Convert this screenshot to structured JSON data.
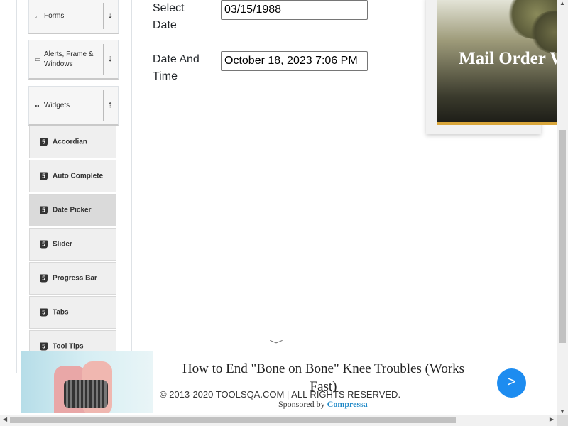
{
  "sidebar": {
    "groups": [
      {
        "label": "Forms",
        "icon": "form-icon",
        "arrow": "⇣"
      },
      {
        "label": "Alerts, Frame & Windows",
        "icon": "window-icon",
        "arrow": "⇣"
      },
      {
        "label": "Widgets",
        "icon": "widgets-icon",
        "arrow": "⇡"
      }
    ],
    "items": [
      {
        "label": "Accordian"
      },
      {
        "label": "Auto Complete"
      },
      {
        "label": "Date Picker"
      },
      {
        "label": "Slider"
      },
      {
        "label": "Progress Bar"
      },
      {
        "label": "Tabs"
      },
      {
        "label": "Tool Tips"
      }
    ],
    "item_icon_glyph": "5",
    "active_item": "Date Picker"
  },
  "form": {
    "select_date_label": "Select Date",
    "select_date_value": "03/15/1988",
    "date_time_label": "Date And Time",
    "date_time_value": "October 18, 2023 7:06 PM"
  },
  "side_ad": {
    "title": "Mail Order W Real Thing, Amazi"
  },
  "bottom_ad": {
    "headline": "How to End \"Bone on Bone\" Knee Troubles (Works Fast)",
    "sponsored_prefix": "Sponsored by",
    "sponsor": "Compressa",
    "next_label": ">"
  },
  "footer": {
    "copyright": "© 2013-2020 TOOLSQA.COM | ALL RIGHTS RESERVED."
  },
  "colors": {
    "accent_blue": "#1d8cf0",
    "ad_border_gold": "#d9a63b"
  }
}
